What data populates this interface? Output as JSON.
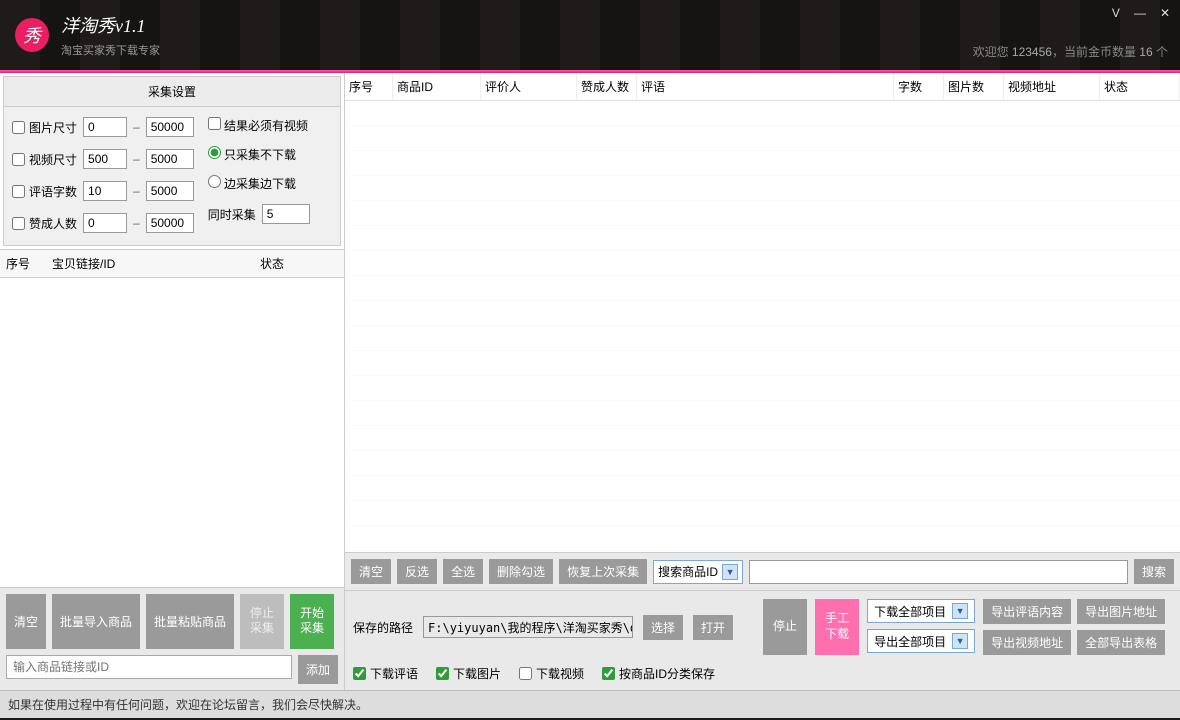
{
  "header": {
    "logo_char": "秀",
    "title": "洋淘秀v1.1",
    "subtitle": "淘宝买家秀下载专家",
    "welcome_prefix": "欢迎您 ",
    "welcome_user": "123456",
    "welcome_mid": "，当前金币数量 ",
    "welcome_coins": "16",
    "welcome_suffix": " 个"
  },
  "settings": {
    "title": "采集设置",
    "rows": {
      "pic_size": "图片尺寸",
      "vid_size": "视频尺寸",
      "cmt_len": "评语字数",
      "likes": "赞成人数"
    },
    "vals": {
      "pic_min": "0",
      "pic_max": "50000",
      "vid_min": "500",
      "vid_max": "5000",
      "cmt_min": "10",
      "cmt_max": "5000",
      "like_min": "0",
      "like_max": "50000"
    },
    "opt_need_video": "结果必须有视频",
    "opt_collect_only": "只采集不下载",
    "opt_collect_dl": "边采集边下载",
    "concurrent_label": "同时采集",
    "concurrent_val": "5"
  },
  "left_grid": {
    "h_seq": "序号",
    "h_link": "宝贝链接/ID",
    "h_stat": "状态"
  },
  "left_bottom": {
    "clear": "清空",
    "import": "批量导入商品",
    "paste": "批量粘贴商品",
    "stop": "停止\n采集",
    "start": "开始\n采集",
    "input_ph": "输入商品链接或ID",
    "add": "添加"
  },
  "grid": {
    "seq": "序号",
    "pid": "商品ID",
    "rev": "评价人",
    "like": "赞成人数",
    "cmt": "评语",
    "words": "字数",
    "pics": "图片数",
    "vid": "视频地址",
    "stat": "状态"
  },
  "midbar": {
    "clear": "清空",
    "invert": "反选",
    "all": "全选",
    "delchk": "删除勾选",
    "restore": "恢复上次采集",
    "search_sel": "搜索商品ID",
    "search_btn": "搜索"
  },
  "bottom": {
    "path_label": "保存的路径",
    "path_value": "F:\\yiyuyan\\我的程序\\洋淘买家秀\\data",
    "choose": "选择",
    "open": "打开",
    "stop": "停止",
    "manual": "手工\n下载",
    "sel_download": "下载全部项目",
    "sel_export": "导出全部项目",
    "exp_cmt": "导出评语内容",
    "exp_pic": "导出图片地址",
    "exp_vid": "导出视频地址",
    "exp_all": "全部导出表格",
    "ck_cmt": "下载评语",
    "ck_pic": "下载图片",
    "ck_vid": "下载视频",
    "ck_split": "按商品ID分类保存"
  },
  "status": "如果在使用过程中有任何问题，欢迎在论坛留言，我们会尽快解决。"
}
